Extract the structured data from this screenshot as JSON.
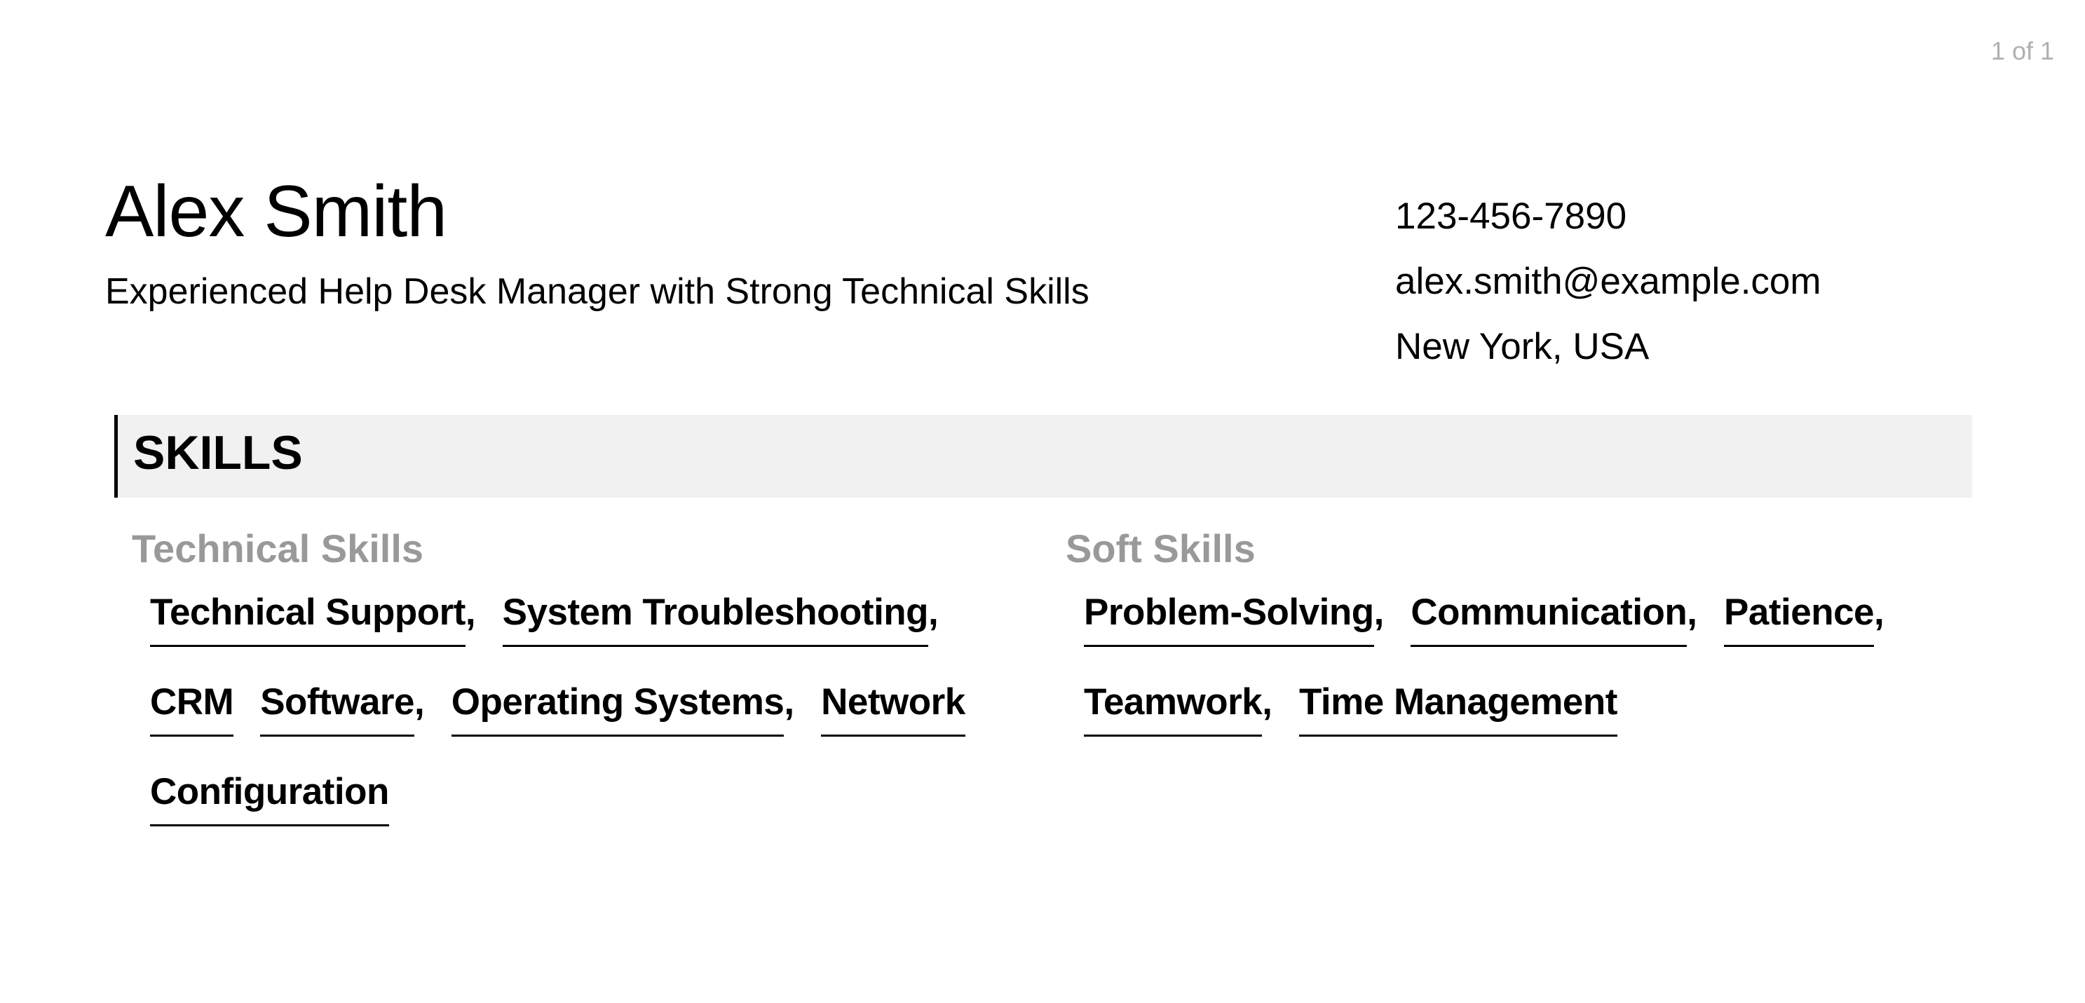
{
  "page_counter": "1 of 1",
  "header": {
    "name": "Alex Smith",
    "subtitle": "Experienced Help Desk Manager with Strong Technical Skills"
  },
  "contact": {
    "phone": "123-456-7890",
    "email": "alex.smith@example.com",
    "location": "New York, USA"
  },
  "skills_section": {
    "title": "SKILLS",
    "groups": [
      {
        "title": "Technical Skills",
        "items": [
          {
            "label": "Technical Support",
            "sep": ","
          },
          {
            "label": "System Troubleshooting",
            "sep": ","
          },
          {
            "label": "CRM",
            "sep": ""
          },
          {
            "label": "Software",
            "sep": ","
          },
          {
            "label": "Operating Systems",
            "sep": ","
          },
          {
            "label": "Network",
            "sep": ""
          },
          {
            "label": "Configuration",
            "sep": ""
          }
        ]
      },
      {
        "title": "Soft Skills",
        "items": [
          {
            "label": "Problem-Solving",
            "sep": ","
          },
          {
            "label": "Communication",
            "sep": ","
          },
          {
            "label": "Patience",
            "sep": ","
          },
          {
            "label": "Teamwork",
            "sep": ","
          },
          {
            "label": "Time Management",
            "sep": ""
          }
        ]
      }
    ]
  },
  "colors": {
    "text": "#000000",
    "muted": "#999999",
    "section_bg": "#f1f1f1",
    "page_counter": "#b0b0b0"
  }
}
